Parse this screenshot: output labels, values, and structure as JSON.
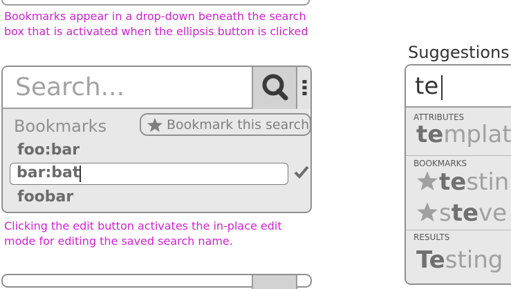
{
  "notes": {
    "bookmarks_dropdown": "Bookmarks appear in a drop-down beneath the search box that is activated when the ellipsis button is clicked",
    "line1a": "Bookmarks appear in a drop-down beneath the search",
    "line1b": "box that is activated when the ellipsis button is clicked",
    "line2a": "Clicking the edit button activates the in-place edit",
    "line2b": "mode for editing the saved search name."
  },
  "search": {
    "placeholder": "Search...",
    "search_icon": "search-icon",
    "menu_icon": "vertical-ellipsis-icon"
  },
  "bookmarks": {
    "header": "Bookmarks",
    "save_label": "Bookmark this search",
    "items": [
      "foo:bar",
      "bar:bat",
      "foobar"
    ],
    "editing_index": 1,
    "edit_value": "bar:bat",
    "confirm_icon": "checkmark-icon"
  },
  "suggestions": {
    "title": "Suggestions",
    "query": "te",
    "sections": {
      "attributes": "ATTRIBUTES",
      "bookmarks": "BOOKMARKS",
      "results": "RESULTS"
    },
    "attribute_items": [
      {
        "match": "te",
        "rest": "mplate"
      }
    ],
    "bookmark_items": [
      {
        "pre": "",
        "match": "te",
        "rest": "stin"
      },
      {
        "pre": "s",
        "match": "te",
        "rest": "ve"
      }
    ],
    "result_items": [
      {
        "match": "Te",
        "rest": "sting"
      }
    ]
  },
  "colors": {
    "annotation": "#d21fd2",
    "border": "#8f8f8f",
    "panel_bg": "#e8e8e8"
  }
}
